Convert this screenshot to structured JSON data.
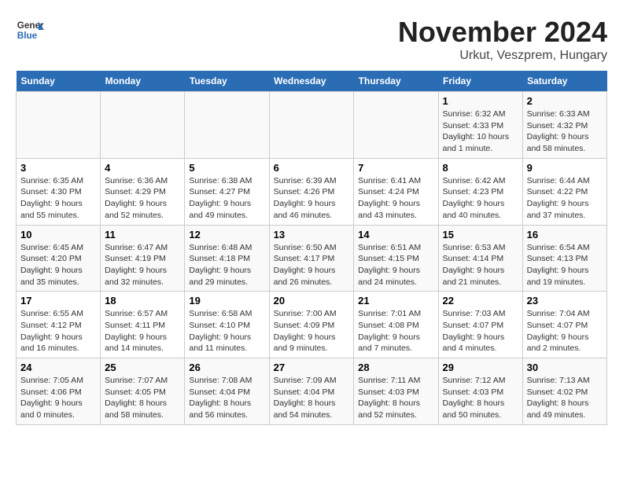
{
  "logo": {
    "line1": "General",
    "line2": "Blue"
  },
  "title": "November 2024",
  "subtitle": "Urkut, Veszprem, Hungary",
  "days_of_week": [
    "Sunday",
    "Monday",
    "Tuesday",
    "Wednesday",
    "Thursday",
    "Friday",
    "Saturday"
  ],
  "weeks": [
    [
      {
        "day": "",
        "info": ""
      },
      {
        "day": "",
        "info": ""
      },
      {
        "day": "",
        "info": ""
      },
      {
        "day": "",
        "info": ""
      },
      {
        "day": "",
        "info": ""
      },
      {
        "day": "1",
        "info": "Sunrise: 6:32 AM\nSunset: 4:33 PM\nDaylight: 10 hours and 1 minute."
      },
      {
        "day": "2",
        "info": "Sunrise: 6:33 AM\nSunset: 4:32 PM\nDaylight: 9 hours and 58 minutes."
      }
    ],
    [
      {
        "day": "3",
        "info": "Sunrise: 6:35 AM\nSunset: 4:30 PM\nDaylight: 9 hours and 55 minutes."
      },
      {
        "day": "4",
        "info": "Sunrise: 6:36 AM\nSunset: 4:29 PM\nDaylight: 9 hours and 52 minutes."
      },
      {
        "day": "5",
        "info": "Sunrise: 6:38 AM\nSunset: 4:27 PM\nDaylight: 9 hours and 49 minutes."
      },
      {
        "day": "6",
        "info": "Sunrise: 6:39 AM\nSunset: 4:26 PM\nDaylight: 9 hours and 46 minutes."
      },
      {
        "day": "7",
        "info": "Sunrise: 6:41 AM\nSunset: 4:24 PM\nDaylight: 9 hours and 43 minutes."
      },
      {
        "day": "8",
        "info": "Sunrise: 6:42 AM\nSunset: 4:23 PM\nDaylight: 9 hours and 40 minutes."
      },
      {
        "day": "9",
        "info": "Sunrise: 6:44 AM\nSunset: 4:22 PM\nDaylight: 9 hours and 37 minutes."
      }
    ],
    [
      {
        "day": "10",
        "info": "Sunrise: 6:45 AM\nSunset: 4:20 PM\nDaylight: 9 hours and 35 minutes."
      },
      {
        "day": "11",
        "info": "Sunrise: 6:47 AM\nSunset: 4:19 PM\nDaylight: 9 hours and 32 minutes."
      },
      {
        "day": "12",
        "info": "Sunrise: 6:48 AM\nSunset: 4:18 PM\nDaylight: 9 hours and 29 minutes."
      },
      {
        "day": "13",
        "info": "Sunrise: 6:50 AM\nSunset: 4:17 PM\nDaylight: 9 hours and 26 minutes."
      },
      {
        "day": "14",
        "info": "Sunrise: 6:51 AM\nSunset: 4:15 PM\nDaylight: 9 hours and 24 minutes."
      },
      {
        "day": "15",
        "info": "Sunrise: 6:53 AM\nSunset: 4:14 PM\nDaylight: 9 hours and 21 minutes."
      },
      {
        "day": "16",
        "info": "Sunrise: 6:54 AM\nSunset: 4:13 PM\nDaylight: 9 hours and 19 minutes."
      }
    ],
    [
      {
        "day": "17",
        "info": "Sunrise: 6:55 AM\nSunset: 4:12 PM\nDaylight: 9 hours and 16 minutes."
      },
      {
        "day": "18",
        "info": "Sunrise: 6:57 AM\nSunset: 4:11 PM\nDaylight: 9 hours and 14 minutes."
      },
      {
        "day": "19",
        "info": "Sunrise: 6:58 AM\nSunset: 4:10 PM\nDaylight: 9 hours and 11 minutes."
      },
      {
        "day": "20",
        "info": "Sunrise: 7:00 AM\nSunset: 4:09 PM\nDaylight: 9 hours and 9 minutes."
      },
      {
        "day": "21",
        "info": "Sunrise: 7:01 AM\nSunset: 4:08 PM\nDaylight: 9 hours and 7 minutes."
      },
      {
        "day": "22",
        "info": "Sunrise: 7:03 AM\nSunset: 4:07 PM\nDaylight: 9 hours and 4 minutes."
      },
      {
        "day": "23",
        "info": "Sunrise: 7:04 AM\nSunset: 4:07 PM\nDaylight: 9 hours and 2 minutes."
      }
    ],
    [
      {
        "day": "24",
        "info": "Sunrise: 7:05 AM\nSunset: 4:06 PM\nDaylight: 9 hours and 0 minutes."
      },
      {
        "day": "25",
        "info": "Sunrise: 7:07 AM\nSunset: 4:05 PM\nDaylight: 8 hours and 58 minutes."
      },
      {
        "day": "26",
        "info": "Sunrise: 7:08 AM\nSunset: 4:04 PM\nDaylight: 8 hours and 56 minutes."
      },
      {
        "day": "27",
        "info": "Sunrise: 7:09 AM\nSunset: 4:04 PM\nDaylight: 8 hours and 54 minutes."
      },
      {
        "day": "28",
        "info": "Sunrise: 7:11 AM\nSunset: 4:03 PM\nDaylight: 8 hours and 52 minutes."
      },
      {
        "day": "29",
        "info": "Sunrise: 7:12 AM\nSunset: 4:03 PM\nDaylight: 8 hours and 50 minutes."
      },
      {
        "day": "30",
        "info": "Sunrise: 7:13 AM\nSunset: 4:02 PM\nDaylight: 8 hours and 49 minutes."
      }
    ]
  ]
}
